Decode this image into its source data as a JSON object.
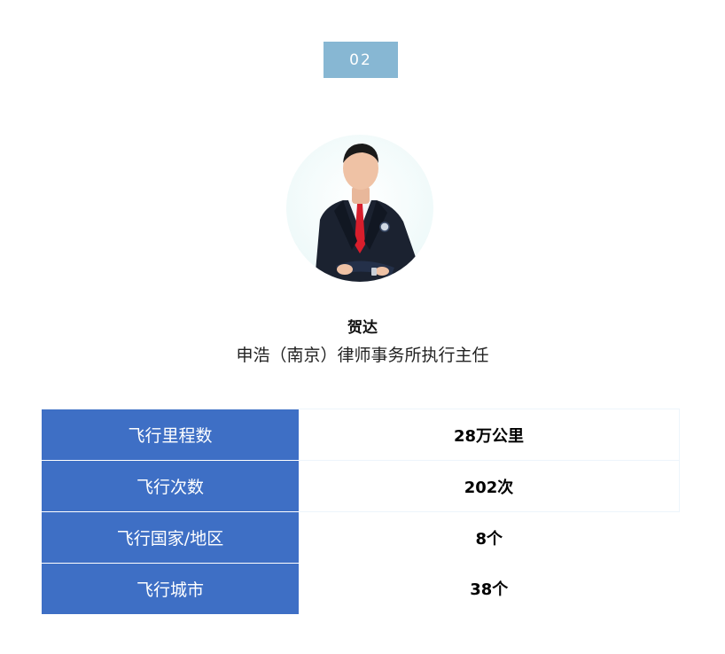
{
  "badge": {
    "number": "02"
  },
  "person": {
    "name": "贺达",
    "title": "申浩（南京）律师事务所执行主任"
  },
  "stats": [
    {
      "label": "飞行里程数",
      "value": "28万公里"
    },
    {
      "label": "飞行次数",
      "value": "202次"
    },
    {
      "label": "飞行国家/地区",
      "value": "8个"
    },
    {
      "label": "飞行城市",
      "value": "38个"
    }
  ],
  "colors": {
    "badge_bg": "#87b7d3",
    "label_bg": "#3e6fc5",
    "tie": "#d81e2c"
  }
}
